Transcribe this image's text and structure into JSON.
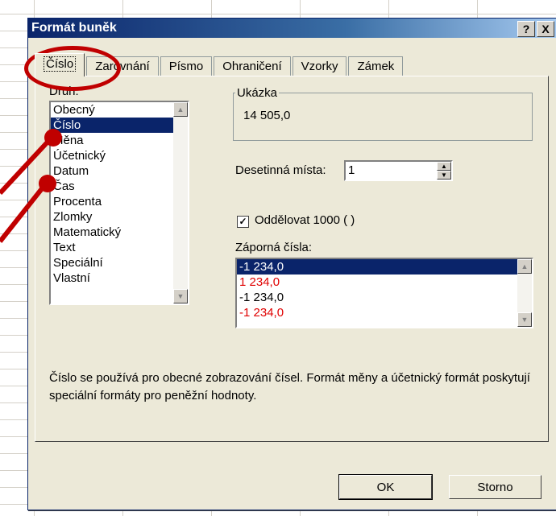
{
  "dialog": {
    "title": "Formát buněk",
    "help_label": "?",
    "close_label": "X"
  },
  "tabs": [
    {
      "label": "Číslo",
      "active": true
    },
    {
      "label": "Zarovnání",
      "active": false
    },
    {
      "label": "Písmo",
      "active": false
    },
    {
      "label": "Ohraničení",
      "active": false
    },
    {
      "label": "Vzorky",
      "active": false
    },
    {
      "label": "Zámek",
      "active": false
    }
  ],
  "category": {
    "label": "Druh:",
    "items": [
      "Obecný",
      "Číslo",
      "Měna",
      "Účetnický",
      "Datum",
      "Čas",
      "Procenta",
      "Zlomky",
      "Matematický",
      "Text",
      "Speciální",
      "Vlastní"
    ],
    "selected_index": 1
  },
  "sample": {
    "label": "Ukázka",
    "value": "14 505,0"
  },
  "decimals": {
    "label": "Desetinná místa:",
    "value": "1"
  },
  "separator": {
    "label": "Oddělovat 1000 ( )",
    "checked": true
  },
  "negative": {
    "label": "Záporná čísla:",
    "items": [
      {
        "text": "-1 234,0",
        "color": "#ffffff",
        "selected": true
      },
      {
        "text": "1 234,0",
        "color": "#e00000",
        "selected": false
      },
      {
        "text": "-1 234,0",
        "color": "#000000",
        "selected": false
      },
      {
        "text": "-1 234,0",
        "color": "#e00000",
        "selected": false
      }
    ]
  },
  "description": "Číslo se používá pro obecné zobrazování čísel. Formát měny a účetnický formát poskytují speciální formáty pro peněžní hodnoty.",
  "buttons": {
    "ok": "OK",
    "cancel": "Storno"
  },
  "annotation_color": "#c00000"
}
